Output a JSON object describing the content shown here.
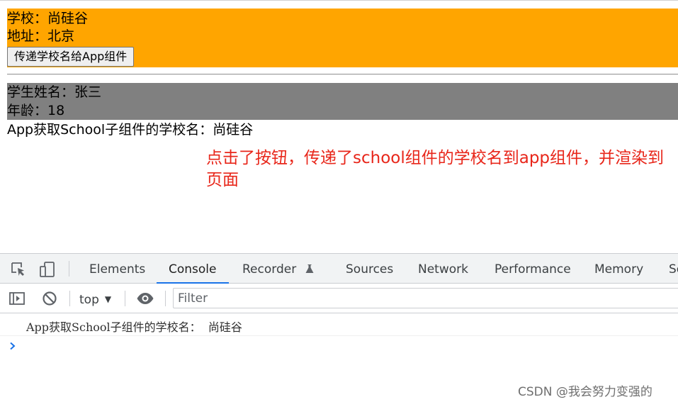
{
  "page": {
    "school": {
      "name_line": "学校：尚硅谷",
      "address_line": "地址：北京",
      "button_label": "传递学校名给App组件"
    },
    "student": {
      "name_line": "学生姓名：张三",
      "age_line": "年龄：18"
    },
    "app_line": "App获取School子组件的学校名：尚硅谷",
    "annotation": "点击了按钮，传递了school组件的学校名到app组件，并渲染到页面",
    "colors": {
      "school_bg": "#ffa500",
      "student_bg": "#808080",
      "annotation": "#e8261a"
    }
  },
  "devtools": {
    "tabs": [
      {
        "label": "Elements"
      },
      {
        "label": "Console",
        "active": true
      },
      {
        "label": "Recorder"
      },
      {
        "label": "Sources"
      },
      {
        "label": "Network"
      },
      {
        "label": "Performance"
      },
      {
        "label": "Memory"
      },
      {
        "label": "Se"
      }
    ],
    "icons": {
      "inspect": "inspect-element-icon",
      "device": "device-toolbar-icon",
      "recorder": "flask-icon",
      "sidebar": "console-sidebar-icon",
      "clear": "clear-console-icon",
      "eye": "live-expression-icon",
      "prompt": "chevron-right-icon"
    },
    "toolbar": {
      "context": "top",
      "filter_placeholder": "Filter"
    },
    "console_messages": [
      "App获取School子组件的学校名：  尚硅谷"
    ],
    "accent": "#1a73e8"
  },
  "watermark": "CSDN @我会努力变强的"
}
